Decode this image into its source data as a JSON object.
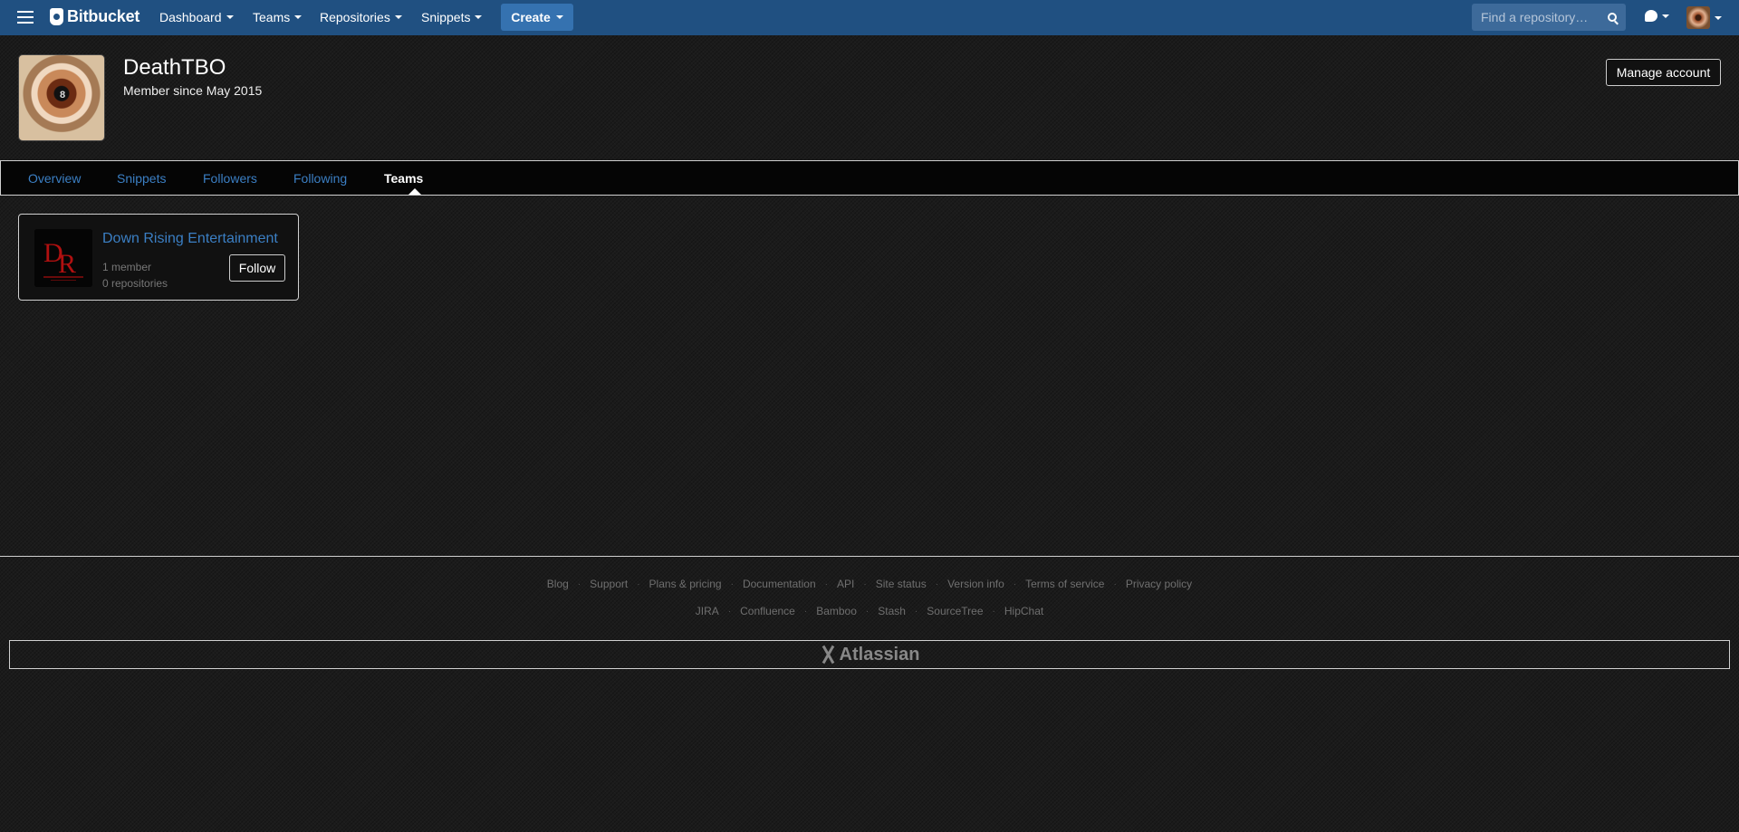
{
  "nav": {
    "logo": "Bitbucket",
    "items": [
      {
        "label": "Dashboard"
      },
      {
        "label": "Teams"
      },
      {
        "label": "Repositories"
      },
      {
        "label": "Snippets"
      }
    ],
    "create_label": "Create",
    "search_placeholder": "Find a repository…",
    "icons": {
      "menu": "hamburger-icon",
      "help": "help-bubble-icon",
      "search": "search-icon"
    }
  },
  "profile": {
    "name": "DeathTBO",
    "member_since": "Member since May 2015",
    "avatar_glyph": "8",
    "manage_label": "Manage account"
  },
  "tabs": [
    {
      "label": "Overview",
      "active": false
    },
    {
      "label": "Snippets",
      "active": false
    },
    {
      "label": "Followers",
      "active": false
    },
    {
      "label": "Following",
      "active": false
    },
    {
      "label": "Teams",
      "active": true
    }
  ],
  "team": {
    "name": "Down Rising Entertainment",
    "avatar_initials": "DR",
    "members": "1 member",
    "repositories": "0 repositories",
    "follow_label": "Follow"
  },
  "footer": {
    "links_row1": [
      "Blog",
      "Support",
      "Plans & pricing",
      "Documentation",
      "API",
      "Site status",
      "Version info",
      "Terms of service",
      "Privacy policy"
    ],
    "links_row2": [
      "JIRA",
      "Confluence",
      "Bamboo",
      "Stash",
      "SourceTree",
      "HipChat"
    ],
    "brand": "Atlassian"
  },
  "colors": {
    "nav_bg": "#205081",
    "create_bg": "#3572b0",
    "link": "#3b7fc4",
    "team_avatar_red": "#b01010"
  }
}
